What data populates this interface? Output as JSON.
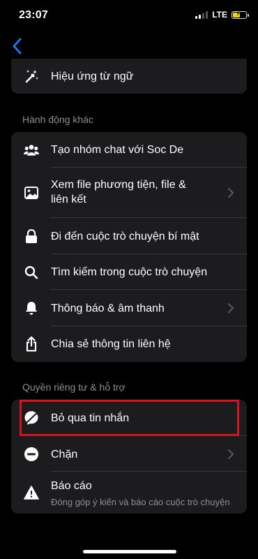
{
  "status_bar": {
    "time": "23:07",
    "network": "LTE"
  },
  "top_group": {
    "items": [
      {
        "label": "Hiệu ứng từ ngữ",
        "icon": "magic-wand-icon"
      }
    ]
  },
  "other_actions": {
    "header": "Hành động khác",
    "items": [
      {
        "label": "Tạo nhóm chat với Soc De",
        "icon": "group-icon",
        "chevron": false
      },
      {
        "label": "Xem file phương tiện, file & liên kết",
        "icon": "image-icon",
        "chevron": true
      },
      {
        "label": "Đi đến cuộc trò chuyện bí mật",
        "icon": "lock-icon",
        "chevron": false
      },
      {
        "label": "Tìm kiếm trong cuộc trò chuyện",
        "icon": "search-icon",
        "chevron": false
      },
      {
        "label": "Thông báo & âm thanh",
        "icon": "bell-icon",
        "chevron": true
      },
      {
        "label": "Chia sẻ thông tin liên hệ",
        "icon": "share-icon",
        "chevron": false
      }
    ]
  },
  "privacy": {
    "header": "Quyền riêng tư & hỗ trợ",
    "items": [
      {
        "label": "Bỏ qua tin nhắn",
        "icon": "ignore-message-icon",
        "chevron": false
      },
      {
        "label": "Chặn",
        "icon": "block-icon",
        "chevron": true
      },
      {
        "label": "Báo cáo",
        "sublabel": "Đóng góp ý kiến và báo cáo cuộc trò chuyện",
        "icon": "warning-icon",
        "chevron": false
      }
    ]
  },
  "colors": {
    "background": "#000000",
    "card": "#1c1c1e",
    "accent": "#0a84ff",
    "highlight": "#d6131e",
    "secondary_text": "#8e8e93"
  }
}
